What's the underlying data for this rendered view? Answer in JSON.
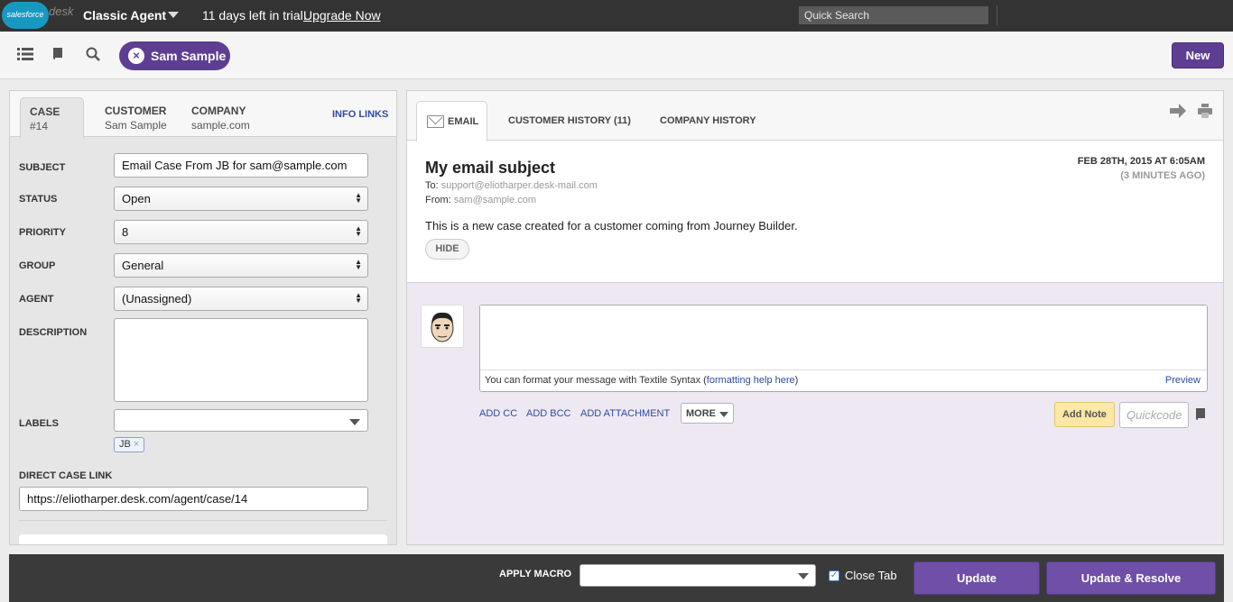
{
  "topbar": {
    "logo_brand": "salesforce",
    "logo_product": "desk",
    "agent_name": "Classic Agent",
    "trial_text": "11 days left in trial.",
    "upgrade_link": "Upgrade Now",
    "quick_search_placeholder": "Quick Search"
  },
  "toolbar": {
    "icons": [
      "list-icon",
      "book-icon",
      "search-icon"
    ],
    "active_customer": "Sam Sample",
    "new_label": "New"
  },
  "left_panel": {
    "tabs": [
      {
        "title": "CASE",
        "sub": "#14"
      },
      {
        "title": "CUSTOMER",
        "sub": "Sam Sample"
      },
      {
        "title": "COMPANY",
        "sub": "sample.com"
      }
    ],
    "info_links": "INFO LINKS",
    "fields": {
      "subject_label": "SUBJECT",
      "subject_value": "Email Case From JB for sam@sample.com",
      "status_label": "STATUS",
      "status_value": "Open",
      "priority_label": "PRIORITY",
      "priority_value": "8",
      "group_label": "GROUP",
      "group_value": "General",
      "agent_label": "AGENT",
      "agent_value": "(Unassigned)",
      "description_label": "DESCRIPTION",
      "description_value": "",
      "labels_label": "LABELS",
      "labels_tags": [
        "JB"
      ],
      "direct_link_label": "DIRECT CASE LINK",
      "direct_link_value": "https://eliotharper.desk.com/agent/case/14"
    }
  },
  "right_panel": {
    "tabs": [
      "EMAIL",
      "CUSTOMER HISTORY (11)",
      "COMPANY HISTORY"
    ],
    "email": {
      "subject": "My email subject",
      "to_label": "To:",
      "to": "support@eliotharper.desk-mail.com",
      "from_label": "From:",
      "from": "sam@sample.com",
      "date": "FEB 28TH, 2015 AT 6:05AM",
      "ago": "(3 MINUTES AGO)",
      "body": "This is a new case created for a customer coming from Journey Builder.",
      "hide_label": "HIDE"
    },
    "reply": {
      "format_text": "You can format your message with Textile Syntax (",
      "format_link": "formatting help here",
      "format_end": ")",
      "preview": "Preview",
      "add_cc": "ADD CC",
      "add_bcc": "ADD BCC",
      "add_attachment": "ADD ATTACHMENT",
      "more": "MORE",
      "add_note": "Add Note",
      "quickcode_placeholder": "Quickcode"
    }
  },
  "bottombar": {
    "apply_macro": "APPLY MACRO",
    "close_tab": "Close Tab",
    "close_tab_checked": true,
    "update": "Update",
    "update_resolve": "Update & Resolve"
  },
  "colors": {
    "brand_purple": "#5e3e92",
    "topbar_bg": "#333333",
    "link_blue": "#2d4da0",
    "note_yellow": "#fbe7a6"
  }
}
